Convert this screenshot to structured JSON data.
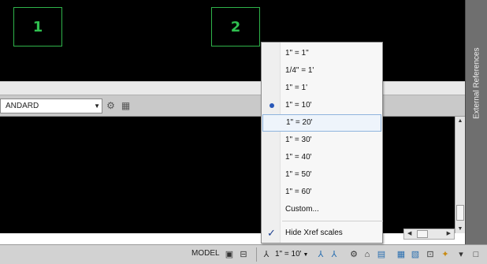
{
  "viewports": [
    {
      "label": "1"
    },
    {
      "label": "2"
    }
  ],
  "toolbar": {
    "style_combo_value": "ANDARD",
    "style_icons": [
      "gear-icon",
      "table-style-icon"
    ]
  },
  "palette": {
    "label": "External References"
  },
  "scale_menu": {
    "items": [
      {
        "label": "1\" = 1\""
      },
      {
        "label": "1/4\" = 1'"
      },
      {
        "label": "1\" = 1'"
      },
      {
        "label": "1\" = 10'",
        "selected": true
      },
      {
        "label": "1\" = 20'",
        "hovered": true
      },
      {
        "label": "1\" = 30'"
      },
      {
        "label": "1\" = 40'"
      },
      {
        "label": "1\" = 50'"
      },
      {
        "label": "1\" = 60'"
      },
      {
        "label": "Custom..."
      }
    ],
    "hide_xref_label": "Hide Xref scales",
    "hide_xref_checked": true
  },
  "statusbar": {
    "model_label": "MODEL",
    "annotation_scale": "1\" = 10'",
    "icons": [
      "layout-icon",
      "quickview-icon",
      "annotation-visibility-icon",
      "annotation-autoscale-icon",
      "workspace-gear-icon",
      "lock-icon",
      "hardware-acceleration-icon",
      "isolate-objects-icon",
      "clean-screen-icon"
    ]
  },
  "colors": {
    "viewport_border": "#2fb34a",
    "menu_highlight": "#8fb4dd",
    "radio": "#2857b8"
  }
}
